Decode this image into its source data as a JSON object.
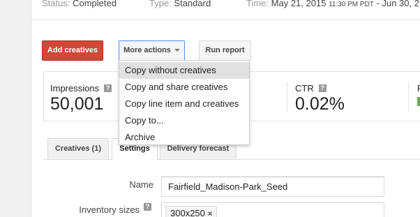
{
  "status": {
    "status_label": "Status:",
    "status_value": "Completed",
    "type_label": "Type:",
    "type_value": "Standard",
    "time_label": "Time:",
    "time_date": "May 21, 2015",
    "time_small": "11:30 PM PDT",
    "time_rest": "- Jun 30, 2"
  },
  "actions": {
    "add_creatives": "Add creatives",
    "more_actions": "More actions",
    "run_report": "Run report"
  },
  "menu": {
    "items": [
      {
        "label": "Copy without creatives",
        "highlighted": true
      },
      {
        "label": "Copy and share creatives",
        "highlighted": false
      },
      {
        "label": "Copy line item and creatives",
        "highlighted": false
      },
      {
        "label": "Copy to...",
        "highlighted": false
      },
      {
        "label": "Archive",
        "highlighted": false
      }
    ]
  },
  "stats": {
    "impressions_label": "Impressions",
    "impressions_value": "50,001",
    "ctr_label": "CTR",
    "ctr_value": "0.02%",
    "edge_label": "F"
  },
  "tabs": {
    "creatives": "Creatives (1)",
    "settings": "Settings",
    "delivery": "Delivery forecast"
  },
  "form": {
    "name_label": "Name",
    "name_value": "Fairfield_Madison-Park_Seed",
    "inventory_label": "Inventory sizes",
    "inventory_chip": "300x250",
    "chip_remove": "×"
  },
  "help_glyph": "?",
  "colors": {
    "primary_button": "#d14836",
    "focus_border": "#4d90fe",
    "ctr_indicator": "#6aa84f"
  }
}
